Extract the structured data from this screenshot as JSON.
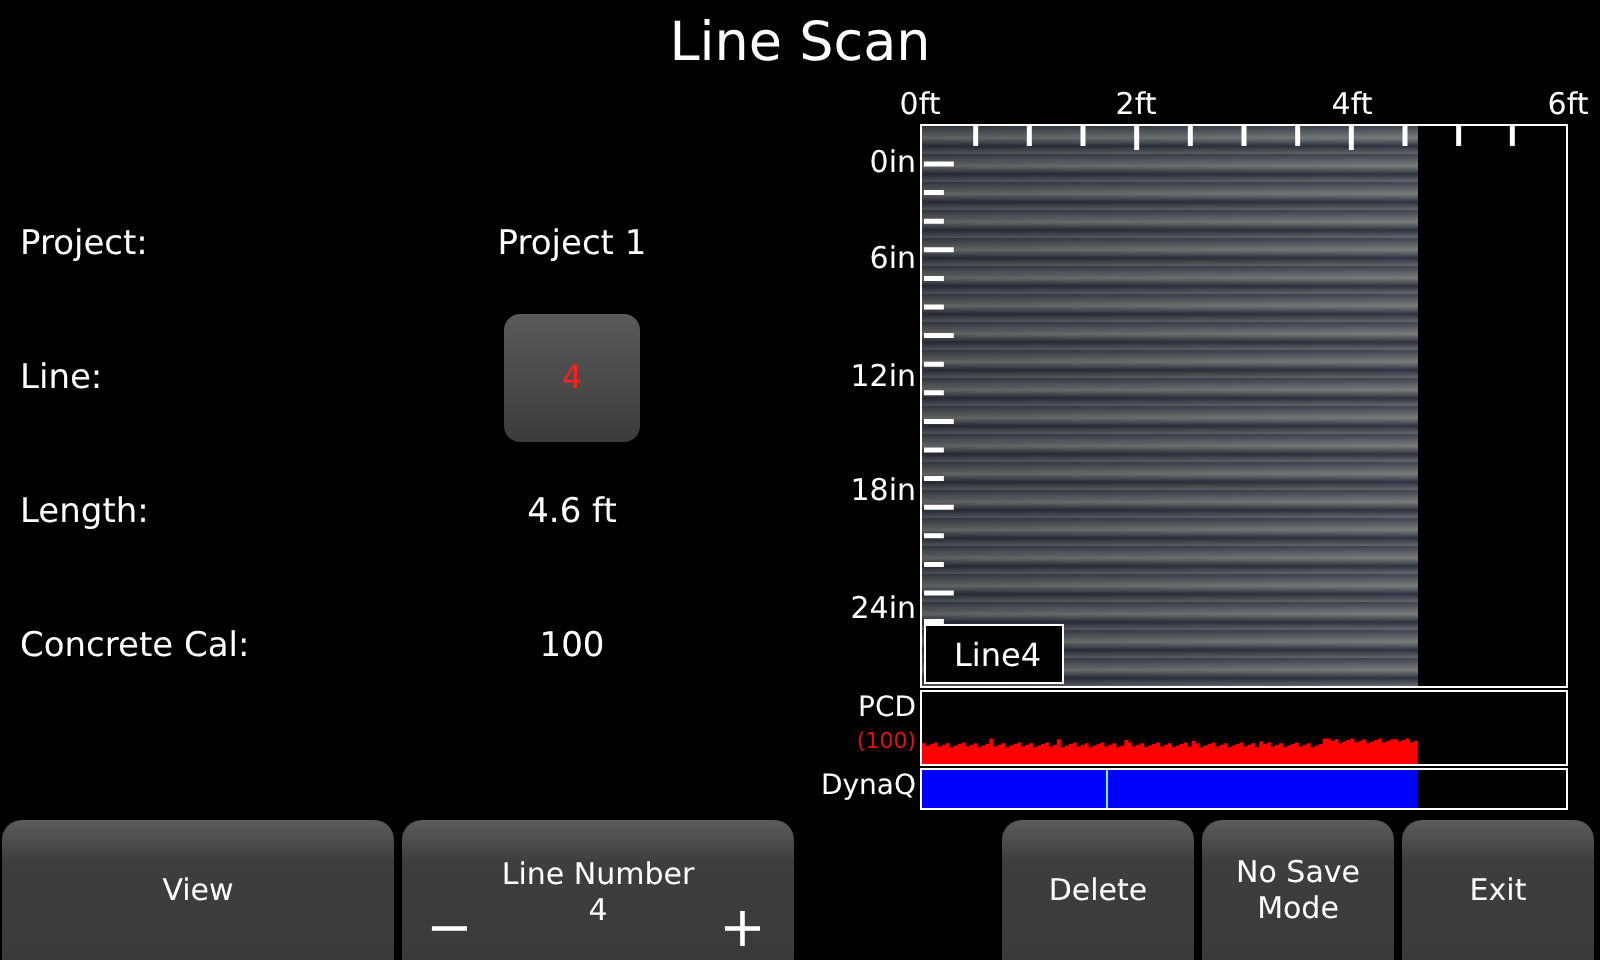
{
  "title": "Line Scan",
  "fields": [
    {
      "kind": "text",
      "label": "Project:",
      "value": "Project 1"
    },
    {
      "kind": "button",
      "label": "Line:",
      "value": "4"
    },
    {
      "kind": "text",
      "label": "Length:",
      "value": "4.6 ft"
    },
    {
      "kind": "text",
      "label": "Concrete Cal:",
      "value": "100"
    }
  ],
  "scan": {
    "x_labels": [
      "0ft",
      "2ft",
      "4ft",
      "6ft"
    ],
    "y_labels": [
      "0in",
      "6in",
      "12in",
      "18in",
      "24in"
    ],
    "line_label": "Line4"
  },
  "pcd": {
    "label": "PCD",
    "value": "(100)"
  },
  "dynaq": {
    "label": "DynaQ",
    "level": 0.77
  },
  "buttons": [
    {
      "kind": "plain",
      "label": "View"
    },
    {
      "kind": "stepper",
      "label": "Line Number",
      "value": "4",
      "minus": "−",
      "plus": "+"
    },
    {
      "kind": "gap"
    },
    {
      "kind": "plain",
      "label": "Delete"
    },
    {
      "kind": "plain",
      "label": "No Save Mode"
    },
    {
      "kind": "plain",
      "label": "Exit"
    }
  ]
}
